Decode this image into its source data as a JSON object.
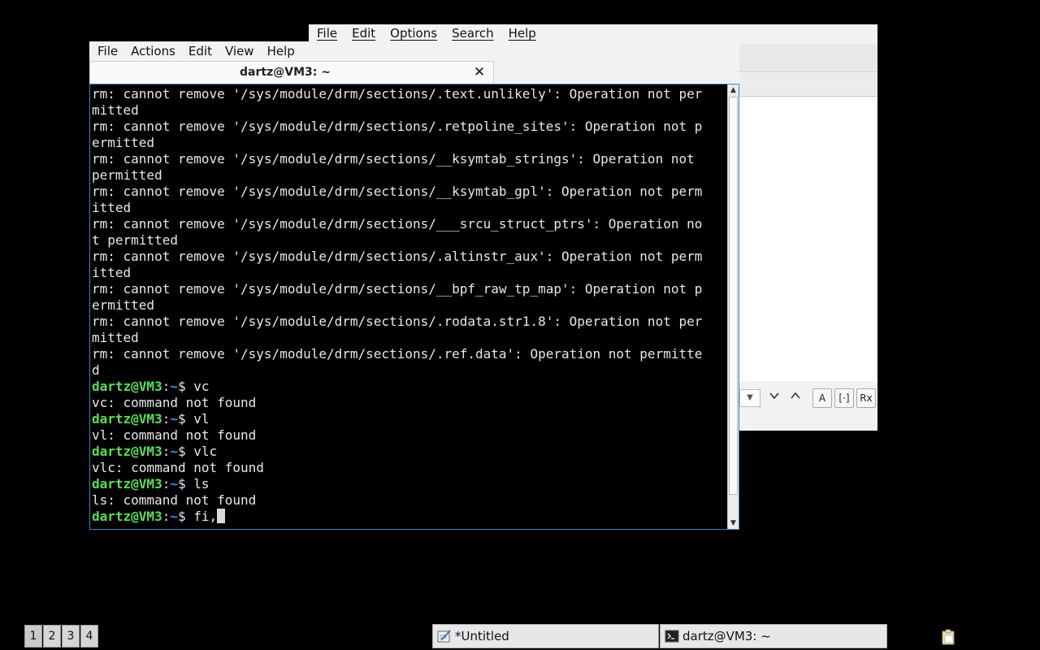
{
  "editor_window": {
    "menu": [
      "File",
      "Edit",
      "Options",
      "Search",
      "Help"
    ],
    "findbar": {
      "dropdown_icon": "chevron-down-icon",
      "prev_icon": "chevron-down-icon",
      "next_icon": "chevron-up-icon",
      "match_case": "A",
      "whole_word": "[·]",
      "regex": "Rx"
    }
  },
  "terminal_window": {
    "menu": [
      "File",
      "Actions",
      "Edit",
      "View",
      "Help"
    ],
    "tab_title": "dartz@VM3: ~",
    "close_symbol": "✕",
    "lines": [
      {
        "type": "out",
        "text": "rm: cannot remove '/sys/module/drm/sections/.text.unlikely': Operation not per"
      },
      {
        "type": "out",
        "text": "mitted"
      },
      {
        "type": "out",
        "text": "rm: cannot remove '/sys/module/drm/sections/.retpoline_sites': Operation not p"
      },
      {
        "type": "out",
        "text": "ermitted"
      },
      {
        "type": "out",
        "text": "rm: cannot remove '/sys/module/drm/sections/__ksymtab_strings': Operation not "
      },
      {
        "type": "out",
        "text": "permitted"
      },
      {
        "type": "out",
        "text": "rm: cannot remove '/sys/module/drm/sections/__ksymtab_gpl': Operation not perm"
      },
      {
        "type": "out",
        "text": "itted"
      },
      {
        "type": "out",
        "text": "rm: cannot remove '/sys/module/drm/sections/___srcu_struct_ptrs': Operation no"
      },
      {
        "type": "out",
        "text": "t permitted"
      },
      {
        "type": "out",
        "text": "rm: cannot remove '/sys/module/drm/sections/.altinstr_aux': Operation not perm"
      },
      {
        "type": "out",
        "text": "itted"
      },
      {
        "type": "out",
        "text": "rm: cannot remove '/sys/module/drm/sections/__bpf_raw_tp_map': Operation not p"
      },
      {
        "type": "out",
        "text": "ermitted"
      },
      {
        "type": "out",
        "text": "rm: cannot remove '/sys/module/drm/sections/.rodata.str1.8': Operation not per"
      },
      {
        "type": "out",
        "text": "mitted"
      },
      {
        "type": "out",
        "text": "rm: cannot remove '/sys/module/drm/sections/.ref.data': Operation not permitte"
      },
      {
        "type": "out",
        "text": "d"
      },
      {
        "type": "prompt",
        "user": "dartz@VM3",
        "path": "~",
        "cmd": "vc"
      },
      {
        "type": "out",
        "text": "vc: command not found"
      },
      {
        "type": "prompt",
        "user": "dartz@VM3",
        "path": "~",
        "cmd": "vl"
      },
      {
        "type": "out",
        "text": "vl: command not found"
      },
      {
        "type": "prompt",
        "user": "dartz@VM3",
        "path": "~",
        "cmd": "vlc"
      },
      {
        "type": "out",
        "text": "vlc: command not found"
      },
      {
        "type": "prompt",
        "user": "dartz@VM3",
        "path": "~",
        "cmd": "ls"
      },
      {
        "type": "out",
        "text": "ls: command not found"
      },
      {
        "type": "prompt",
        "user": "dartz@VM3",
        "path": "~",
        "cmd": "fi,",
        "cursor": true
      }
    ]
  },
  "taskbar": {
    "workspaces": [
      "1",
      "2",
      "3",
      "4"
    ],
    "active_workspace": "1",
    "tasks": [
      {
        "label": "*Untitled",
        "icon": "text-editor-icon"
      },
      {
        "label": "dartz@VM3: ~",
        "icon": "terminal-icon"
      }
    ],
    "tray_icon": "clipboard-icon"
  },
  "colors": {
    "prompt_user": "#55e055",
    "prompt_path": "#5b7fff",
    "terminal_bg": "#000000",
    "terminal_fg": "#e8e8e8",
    "focus_border": "#3a7fd0"
  }
}
